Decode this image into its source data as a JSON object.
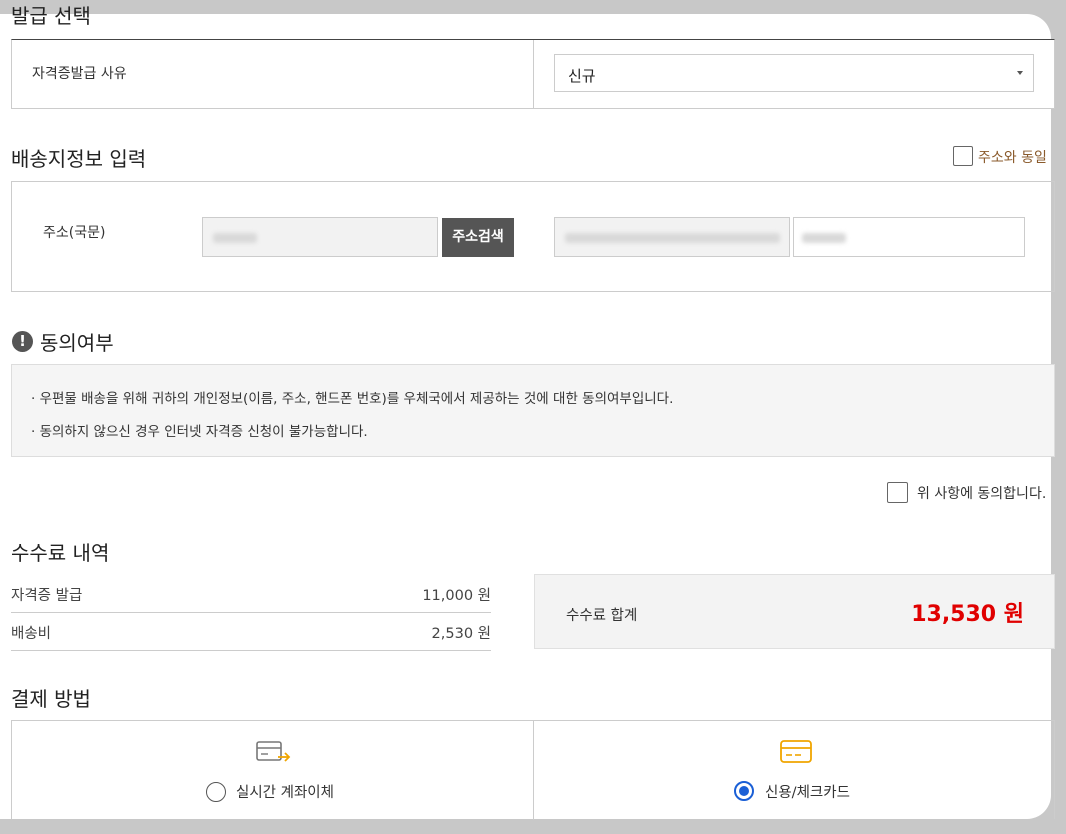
{
  "issue": {
    "title": "발급 선택",
    "reason_label": "자격증발급 사유",
    "reason_value": "신규"
  },
  "shipping": {
    "title": "배송지정보 입력",
    "same_as_address_label": "주소와 동일",
    "address_label": "주소(국문)",
    "search_button": "주소검색"
  },
  "consent": {
    "title": "동의여부",
    "line1": "· 우편물 배송을 위해 귀하의 개인정보(이름, 주소, 핸드폰 번호)를 우체국에서 제공하는 것에 대한 동의여부입니다.",
    "line2": "· 동의하지 않으신 경우 인터넷 자격증 신청이 불가능합니다.",
    "agree_label": "위 사항에 동의합니다."
  },
  "fees": {
    "title": "수수료 내역",
    "rows": [
      {
        "label": "자격증 발급",
        "amount": "11,000 원"
      },
      {
        "label": "배송비",
        "amount": "2,530 원"
      }
    ],
    "total_label": "수수료 합계",
    "total_value": "13,530 원",
    "total_color": "#e00000"
  },
  "payment": {
    "title": "결제 방법",
    "options": [
      {
        "label": "실시간 계좌이체",
        "icon": "bank-transfer-icon",
        "selected": false
      },
      {
        "label": "신용/체크카드",
        "icon": "credit-card-icon",
        "selected": true
      }
    ]
  },
  "colors": {
    "accent": "#1a5fd6",
    "same_address_label": "#8a5a2b"
  }
}
